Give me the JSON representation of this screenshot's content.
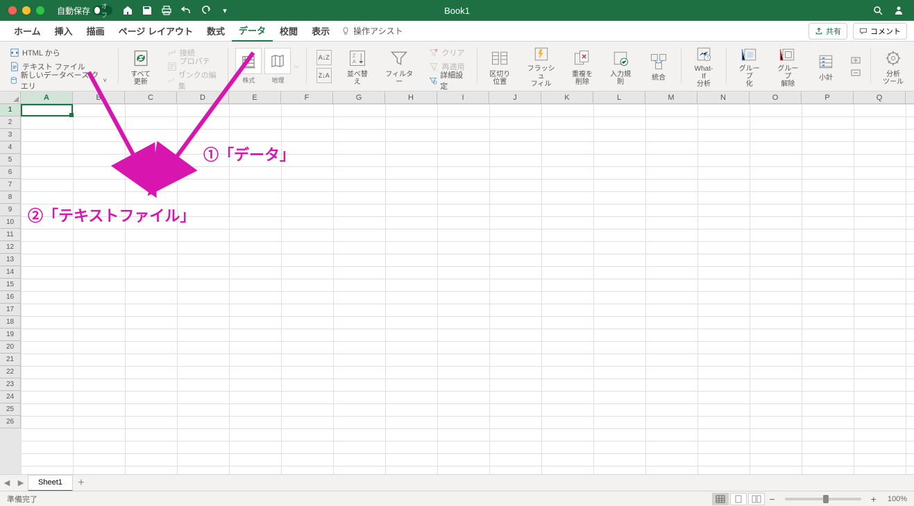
{
  "titlebar": {
    "autosave_label": "自動保存",
    "autosave_off": "オフ",
    "title": "Book1"
  },
  "tabs": {
    "items": [
      "ホーム",
      "挿入",
      "描画",
      "ページ レイアウト",
      "数式",
      "データ",
      "校閲",
      "表示"
    ],
    "active_index": 5,
    "assist": "操作アシスト",
    "share": "共有",
    "comment": "コメント"
  },
  "ribbon": {
    "html_from": "HTML から",
    "text_file": "テキスト ファイル",
    "new_query": "新しいデータベース クエリ",
    "refresh_all": "すべて\n更新",
    "connections": "接続",
    "properties": "プロパティ",
    "edit_links": "リンクの編集",
    "stocks": "株式",
    "geography": "地理",
    "sort": "並べ替え",
    "filter": "フィルター",
    "clear": "クリア",
    "reapply": "再適用",
    "advanced": "詳細設定",
    "text_to_columns": "区切り\n位置",
    "flash_fill": "フラッシュ\nフィル",
    "remove_dupes": "重複を\n削除",
    "data_validation": "入力規則",
    "consolidate": "統合",
    "whatif": "What-If\n分析",
    "group": "グループ\n化",
    "ungroup": "グループ\n解除",
    "subtotal": "小計",
    "analysis": "分析\nツール"
  },
  "columns": [
    "A",
    "B",
    "C",
    "D",
    "E",
    "F",
    "G",
    "H",
    "I",
    "J",
    "K",
    "L",
    "M",
    "N",
    "O",
    "P",
    "Q"
  ],
  "rows": [
    "1",
    "2",
    "3",
    "4",
    "5",
    "6",
    "7",
    "8",
    "9",
    "10",
    "11",
    "12",
    "13",
    "14",
    "15",
    "16",
    "17",
    "18",
    "19",
    "20",
    "21",
    "22",
    "23",
    "24",
    "25",
    "26"
  ],
  "annotations": {
    "a1": "①「データ」",
    "a2": "②「テキストファイル」"
  },
  "sheetbar": {
    "sheet1": "Sheet1"
  },
  "statusbar": {
    "ready": "準備完了",
    "zoom": "100%"
  }
}
